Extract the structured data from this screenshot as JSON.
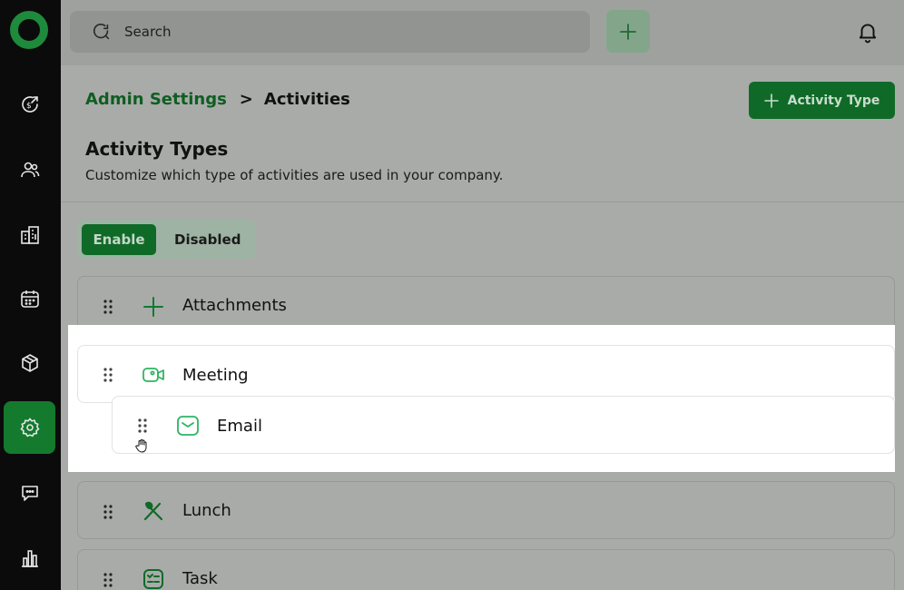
{
  "sidebar": {
    "logo_color": "#1e8a3c",
    "items": [
      {
        "icon": "money-transfer-icon"
      },
      {
        "icon": "contacts-icon"
      },
      {
        "icon": "companies-icon"
      },
      {
        "icon": "calendar-icon"
      },
      {
        "icon": "products-box-icon"
      },
      {
        "icon": "settings-gear-icon",
        "active": true
      },
      {
        "icon": "chat-icon"
      },
      {
        "icon": "reports-chart-icon"
      }
    ]
  },
  "topbar": {
    "search_placeholder": "Search",
    "add_icon": "plus-icon",
    "bell_icon": "bell-icon"
  },
  "breadcrumb": {
    "parent": "Admin Settings",
    "separator": ">",
    "current": "Activities"
  },
  "add_activity_type_button": "Activity Type",
  "page": {
    "title": "Activity Types",
    "subtitle": "Customize which type of activities are used in your company."
  },
  "toggle": {
    "enable": "Enable",
    "disabled": "Disabled"
  },
  "activities": [
    {
      "label": "Attachments",
      "icon": "plus-icon"
    },
    {
      "label": "Meeting",
      "icon": "video-camera-icon"
    },
    {
      "label": "Email",
      "icon": "email-icon"
    },
    {
      "label": "Lunch",
      "icon": "utensils-icon"
    },
    {
      "label": "Task",
      "icon": "task-list-icon"
    }
  ],
  "colors": {
    "accent": "#0f6a27",
    "icon_green": "#2fb463",
    "sidebar_bg": "#0b0b0b"
  }
}
